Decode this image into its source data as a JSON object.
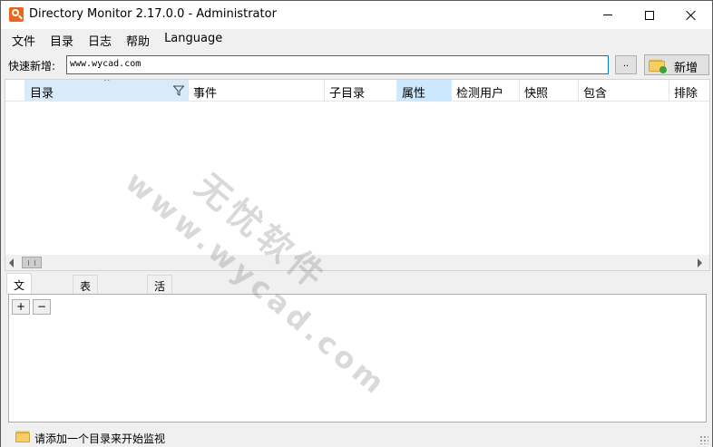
{
  "window": {
    "title": "Directory Monitor 2.17.0.0 - Administrator"
  },
  "menu": {
    "items": [
      "文件",
      "目录",
      "日志",
      "帮助",
      "Language"
    ]
  },
  "quick_add": {
    "label": "快速新增:",
    "value": "www.wycad.com",
    "browse_label": "..",
    "add_label": "新增"
  },
  "grid": {
    "columns": [
      "目录",
      "事件",
      "子目录",
      "属性",
      "检测用户",
      "快照",
      "包含",
      "排除"
    ]
  },
  "log_tabs": [
    "文本日志",
    "表格式日志",
    "活动日志"
  ],
  "log_toolbar": {
    "expand_label": "+",
    "collapse_label": "−"
  },
  "status": {
    "text": "请添加一个目录来开始监视"
  },
  "watermark": {
    "line1": "无忧软件",
    "line2": "www.wycad.com"
  },
  "colors": {
    "app_icon": "#e8661e",
    "active_column": "#cce8ff",
    "input_border": "#0078d7",
    "folder": "#f5cf63"
  }
}
